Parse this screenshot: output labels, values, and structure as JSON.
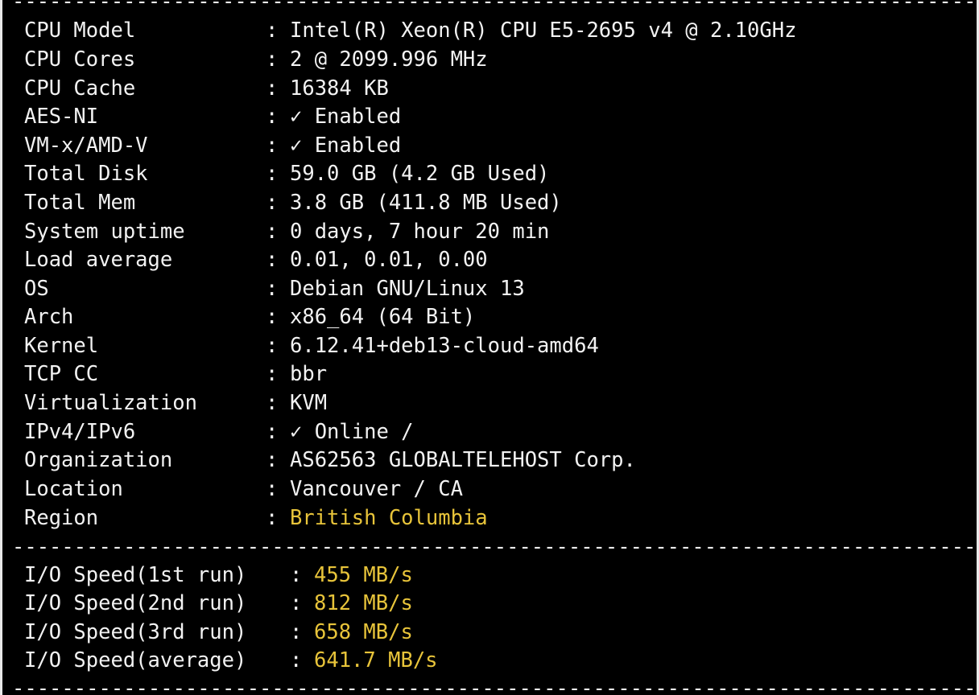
{
  "colors": {
    "background": "#000000",
    "text": "#f2f2f2",
    "highlight": "#e8c43a"
  },
  "separator": "-------------------------------------------------------------------------------------------",
  "sysinfo": [
    {
      "label": "CPU Model",
      "value": "Intel(R) Xeon(R) CPU E5-2695 v4 @ 2.10GHz",
      "highlight": false
    },
    {
      "label": "CPU Cores",
      "value": "2 @ 2099.996 MHz",
      "highlight": false
    },
    {
      "label": "CPU Cache",
      "value": "16384 KB",
      "highlight": false
    },
    {
      "label": "AES-NI",
      "value": "✓ Enabled",
      "highlight": false
    },
    {
      "label": "VM-x/AMD-V",
      "value": "✓ Enabled",
      "highlight": false
    },
    {
      "label": "Total Disk",
      "value": "59.0 GB (4.2 GB Used)",
      "highlight": false
    },
    {
      "label": "Total Mem",
      "value": "3.8 GB (411.8 MB Used)",
      "highlight": false
    },
    {
      "label": "System uptime",
      "value": "0 days, 7 hour 20 min",
      "highlight": false
    },
    {
      "label": "Load average",
      "value": "0.01, 0.01, 0.00",
      "highlight": false
    },
    {
      "label": "OS",
      "value": "Debian GNU/Linux 13",
      "highlight": false
    },
    {
      "label": "Arch",
      "value": "x86_64 (64 Bit)",
      "highlight": false
    },
    {
      "label": "Kernel",
      "value": "6.12.41+deb13-cloud-amd64",
      "highlight": false
    },
    {
      "label": "TCP CC",
      "value": "bbr",
      "highlight": false
    },
    {
      "label": "Virtualization",
      "value": "KVM",
      "highlight": false
    },
    {
      "label": "IPv4/IPv6",
      "value": "✓ Online /",
      "highlight": false
    },
    {
      "label": "Organization",
      "value": "AS62563 GLOBALTELEHOST Corp.",
      "highlight": false
    },
    {
      "label": "Location",
      "value": "Vancouver / CA",
      "highlight": false
    },
    {
      "label": "Region",
      "value": "British Columbia",
      "highlight": true
    }
  ],
  "io": [
    {
      "label": "I/O Speed(1st run)",
      "value": "455 MB/s"
    },
    {
      "label": "I/O Speed(2nd run)",
      "value": "812 MB/s"
    },
    {
      "label": "I/O Speed(3rd run)",
      "value": "658 MB/s"
    },
    {
      "label": "I/O Speed(average)",
      "value": "641.7 MB/s"
    }
  ],
  "colon": ":"
}
